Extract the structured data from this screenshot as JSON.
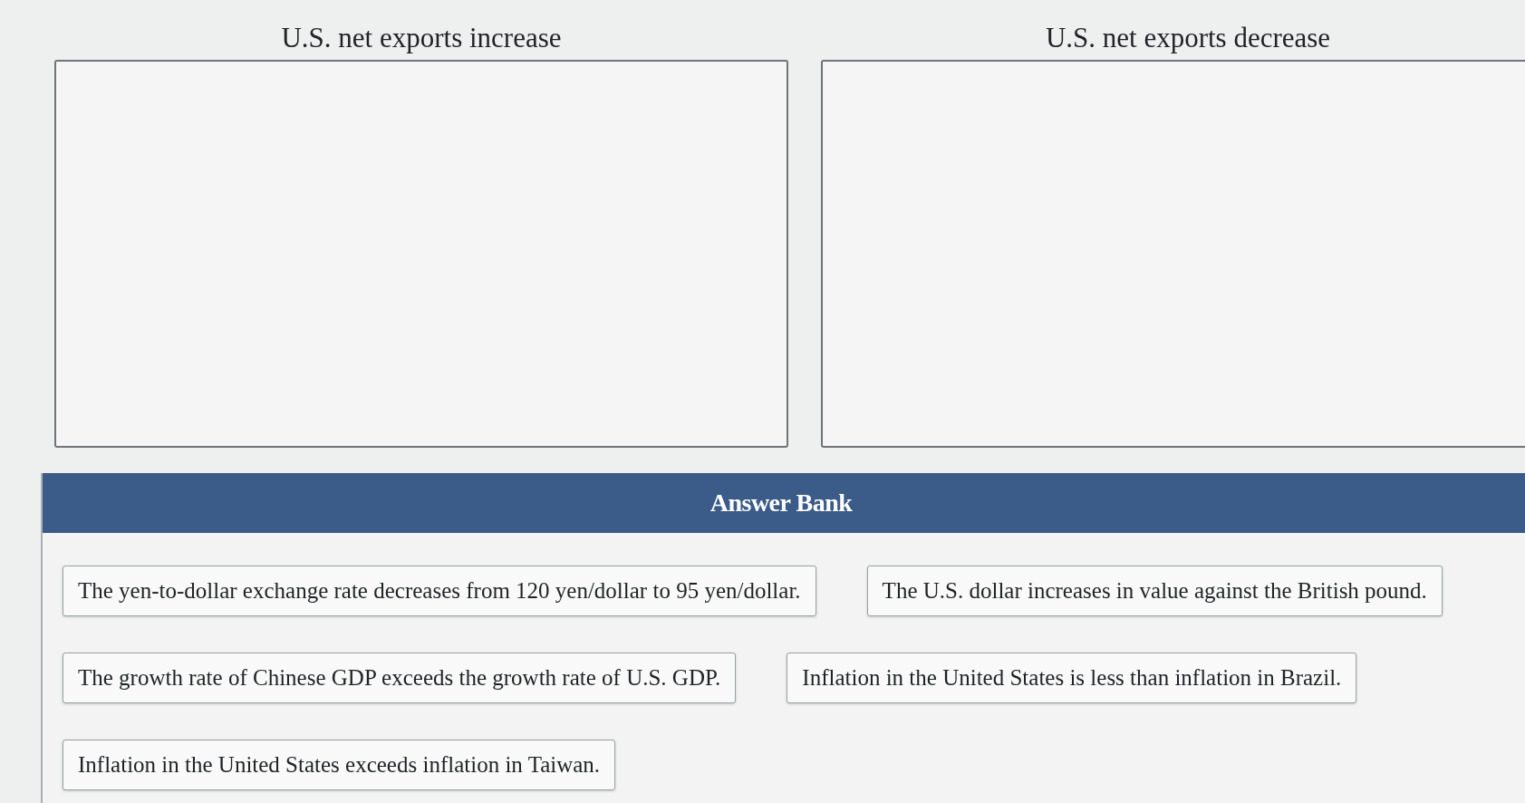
{
  "categories": [
    {
      "title": "U.S. net exports increase"
    },
    {
      "title": "U.S. net exports decrease"
    }
  ],
  "answer_bank": {
    "title": "Answer Bank",
    "items": [
      "The yen-to-dollar exchange rate decreases from 120 yen/dollar to 95 yen/dollar.",
      "The U.S. dollar increases in value against the British pound.",
      "The growth rate of Chinese GDP exceeds the growth rate of U.S. GDP.",
      "Inflation in the United States is less than inflation in Brazil.",
      "Inflation in the United States exceeds inflation in Taiwan."
    ]
  }
}
